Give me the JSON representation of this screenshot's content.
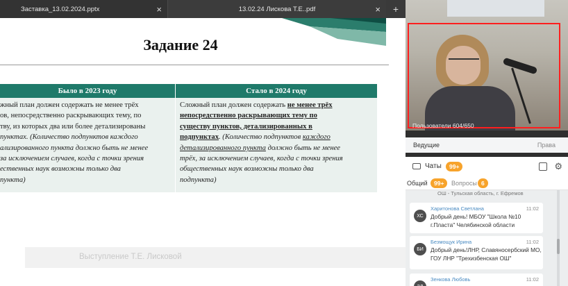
{
  "tabs": [
    {
      "label": "Заставка_13.02.2024.pptx",
      "close": "×"
    },
    {
      "label": "13.02.24 Лискова Т.Е..pdf",
      "close": "×"
    }
  ],
  "tab_plus": "+",
  "slide": {
    "title": "Задание 24",
    "table": {
      "headers": [
        "Было в 2023 году",
        "Стало в 2024 году"
      ],
      "col1_lines": [
        "жный план должен содержать не менее трёх",
        "ов, непосредственно раскрывающих тему, по",
        "тву, из которых два или более детализированы",
        "пунктах. (Количество подпунктов каждого",
        "ализированного пункта должно быть не менее",
        "за исключением случаев, когда с точки зрения",
        "ественных наук возможны только два",
        "пункта)"
      ],
      "col2": {
        "l1a": "Сложный план должен содержать ",
        "l1b": "не менее трёх",
        "l2": "непосредственно раскрывающих тему по",
        "l3": "существу пунктов, детализированных в",
        "l4a": "подпунктах",
        "l4b": ". (Количество подпунктов ",
        "l4c": "каждого",
        "l5a": "детализированного пункта",
        "l5b": " должно быть не менее",
        "l6": "трёх, за исключением случаев, когда с точки зрения",
        "l7": "общественных наук возможны только два",
        "l8": "подпункта)"
      }
    },
    "caption": "Выступление Т.Е. Лисковой"
  },
  "conference": {
    "users_label": "Пользователи  604/650",
    "lead_label": "Ведущие",
    "rights_label": "Права",
    "chats_title": "Чаты",
    "chats_badge": "99+",
    "tab_general": "Общий",
    "tab_general_badge": "99+",
    "tab_questions": "Вопросы",
    "tab_questions_badge": "6",
    "top_snippet": "ОШ - Тульская область, г. Ефремов",
    "messages": [
      {
        "initials": "ХС",
        "name": "Харитонова Светлана",
        "time": "11:02",
        "text": "Добрый день! МБОУ \"Школа №10 г.Пласта\" Челябинской области"
      },
      {
        "initials": "БИ",
        "name": "Безмощук Ирина",
        "time": "11:02",
        "text": "Добрый день!ЛНР, Славяносербский МО, ГОУ ЛНР \"Трехизбенская ОШ\""
      },
      {
        "initials": "ЗЛ",
        "name": "Зенкова Любовь",
        "time": "11:02",
        "text": ""
      }
    ]
  },
  "colors": {
    "table_header": "#1f7a6a",
    "badge": "#f7a32b",
    "highlight_frame": "#ff1e1e"
  }
}
